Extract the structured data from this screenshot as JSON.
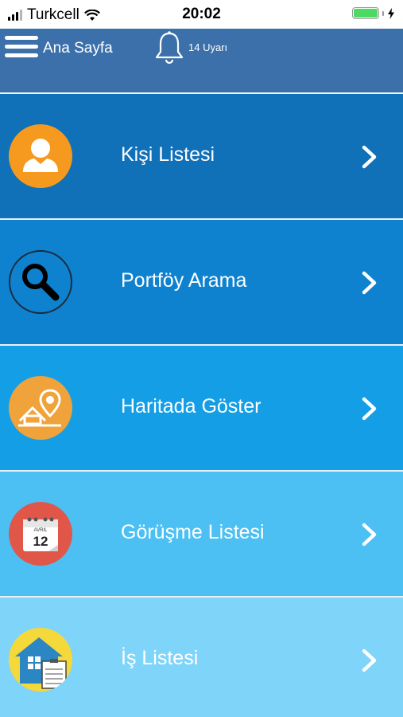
{
  "status_bar": {
    "carrier": "Turkcell",
    "time": "20:02"
  },
  "header": {
    "title": "Ana Sayfa",
    "alerts_label": "14 Uyarı"
  },
  "menu": {
    "items": [
      {
        "label": "Kişi Listesi",
        "icon": "person-icon",
        "color": "#1070b8"
      },
      {
        "label": "Portföy Arama",
        "icon": "magnifier-icon",
        "color": "#0e82cf"
      },
      {
        "label": "Haritada Göster",
        "icon": "map-pin-house-icon",
        "color": "#139ee5"
      },
      {
        "label": "Görüşme Listesi",
        "icon": "calendar-icon",
        "color": "#4cc0f3",
        "calendar_month": "AVRIL",
        "calendar_day": "12"
      },
      {
        "label": "İş Listesi",
        "icon": "house-checklist-icon",
        "color": "#7fd4fa"
      }
    ]
  }
}
